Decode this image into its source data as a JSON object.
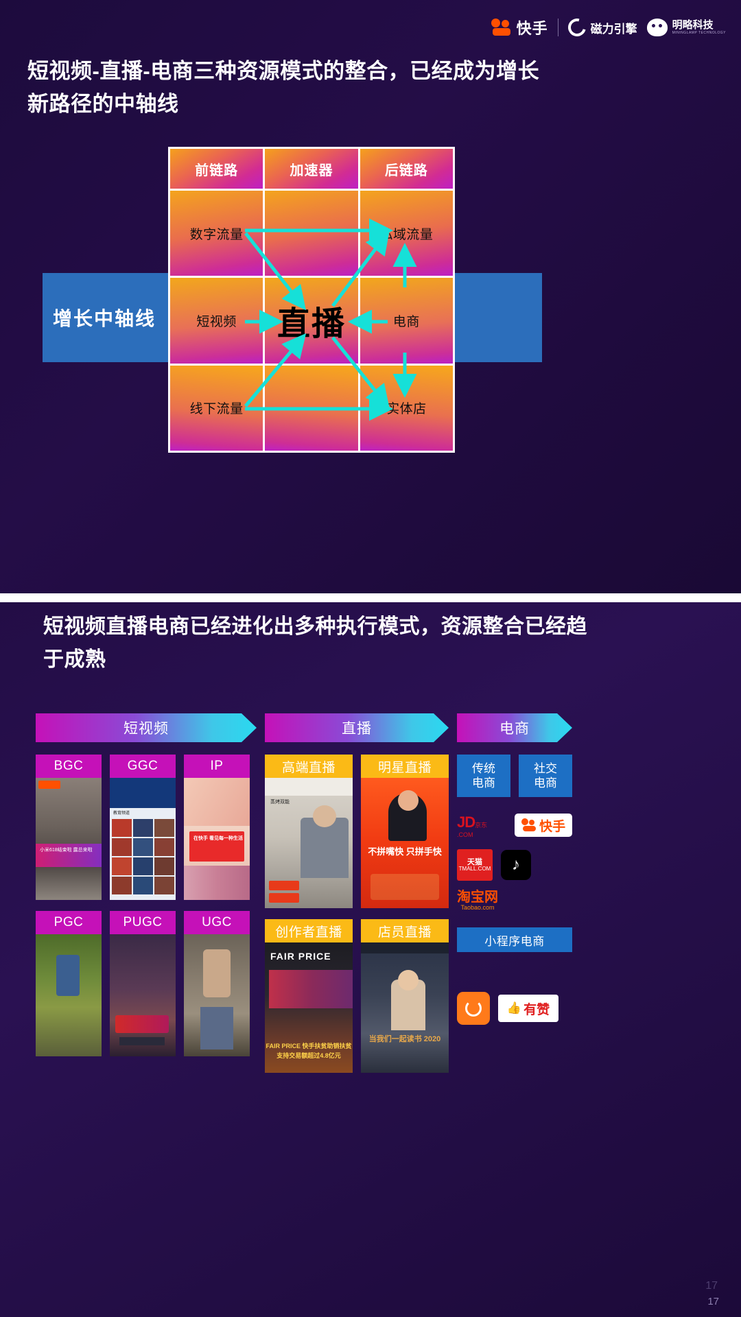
{
  "header": {
    "logos": [
      {
        "name": "kuaishou",
        "text": "快手"
      },
      {
        "name": "cixin-engine",
        "text": "磁力引擎"
      },
      {
        "name": "minglue",
        "text": "明略科技",
        "sub": "MININGLAMP TECHNOLOGY"
      }
    ]
  },
  "slide1": {
    "title": "短视频-直播-电商三种资源模式的整合，已经成为增长新路径的中轴线",
    "axis_label": "增长中轴线",
    "column_headers": [
      "前链路",
      "加速器",
      "后链路"
    ],
    "cells": {
      "row1_left": "数字流量",
      "row1_right": "私域流量",
      "row2_left": "短视频",
      "row2_center": "直播",
      "row2_right": "电商",
      "row3_left": "线下流量",
      "row3_right": "实体店"
    },
    "arrow_color": "#16E0D8"
  },
  "slide2": {
    "title": "短视频直播电商已经进化出多种执行模式，资源整合已经趋于成熟",
    "categories": [
      {
        "name": "short-video",
        "label": "短视频"
      },
      {
        "name": "live-stream",
        "label": "直播"
      },
      {
        "name": "ecommerce",
        "label": "电商"
      }
    ],
    "short_video_tiles": [
      {
        "label": "BGC",
        "caption_color": "#C511B8"
      },
      {
        "label": "GGC",
        "caption_color": "#C511B8"
      },
      {
        "label": "IP",
        "caption_color": "#C511B8"
      },
      {
        "label": "PGC",
        "caption_color": "#C511B8"
      },
      {
        "label": "PUGC",
        "caption_color": "#C511B8"
      },
      {
        "label": "UGC",
        "caption_color": "#C511B8"
      }
    ],
    "live_tiles": [
      {
        "label": "高端直播",
        "caption_color": "#FBBA16"
      },
      {
        "label": "明星直播",
        "caption_color": "#FBBA16"
      },
      {
        "label": "创作者直播",
        "caption_color": "#FBBA16"
      },
      {
        "label": "店员直播",
        "caption_color": "#FBBA16"
      }
    ],
    "ecommerce_boxes": [
      {
        "label": "传统\n电商"
      },
      {
        "label": "社交\n电商"
      }
    ],
    "ecommerce_wide": "小程序电商",
    "brands": [
      {
        "name": "jd",
        "text": "JD",
        "sub": "京东",
        "domain": ".COM"
      },
      {
        "name": "kuaishou",
        "text": "快手"
      },
      {
        "name": "tmall",
        "text": "天猫",
        "sub": "TMALL.COM"
      },
      {
        "name": "tiktok",
        "text": "♪"
      },
      {
        "name": "taobao",
        "text": "淘宝网",
        "sub": "Taobao.com"
      },
      {
        "name": "youdian",
        "text": "有点"
      },
      {
        "name": "youzan",
        "text": "有赞"
      }
    ],
    "tile_texts": {
      "bgc": "小米618结束啦 露总来啦",
      "ggc": "教育频道",
      "ip": "在快手 看见每一种生活",
      "live_highend": "蒸烤双能",
      "live_star": "不拼嘴快 只拼手快",
      "live_creator": "FAIR PRICE 快手扶贫助销扶贫支持交易额超过4.8亿元",
      "live_staff": "当我们一起读书 2020"
    }
  },
  "page_number": "17"
}
